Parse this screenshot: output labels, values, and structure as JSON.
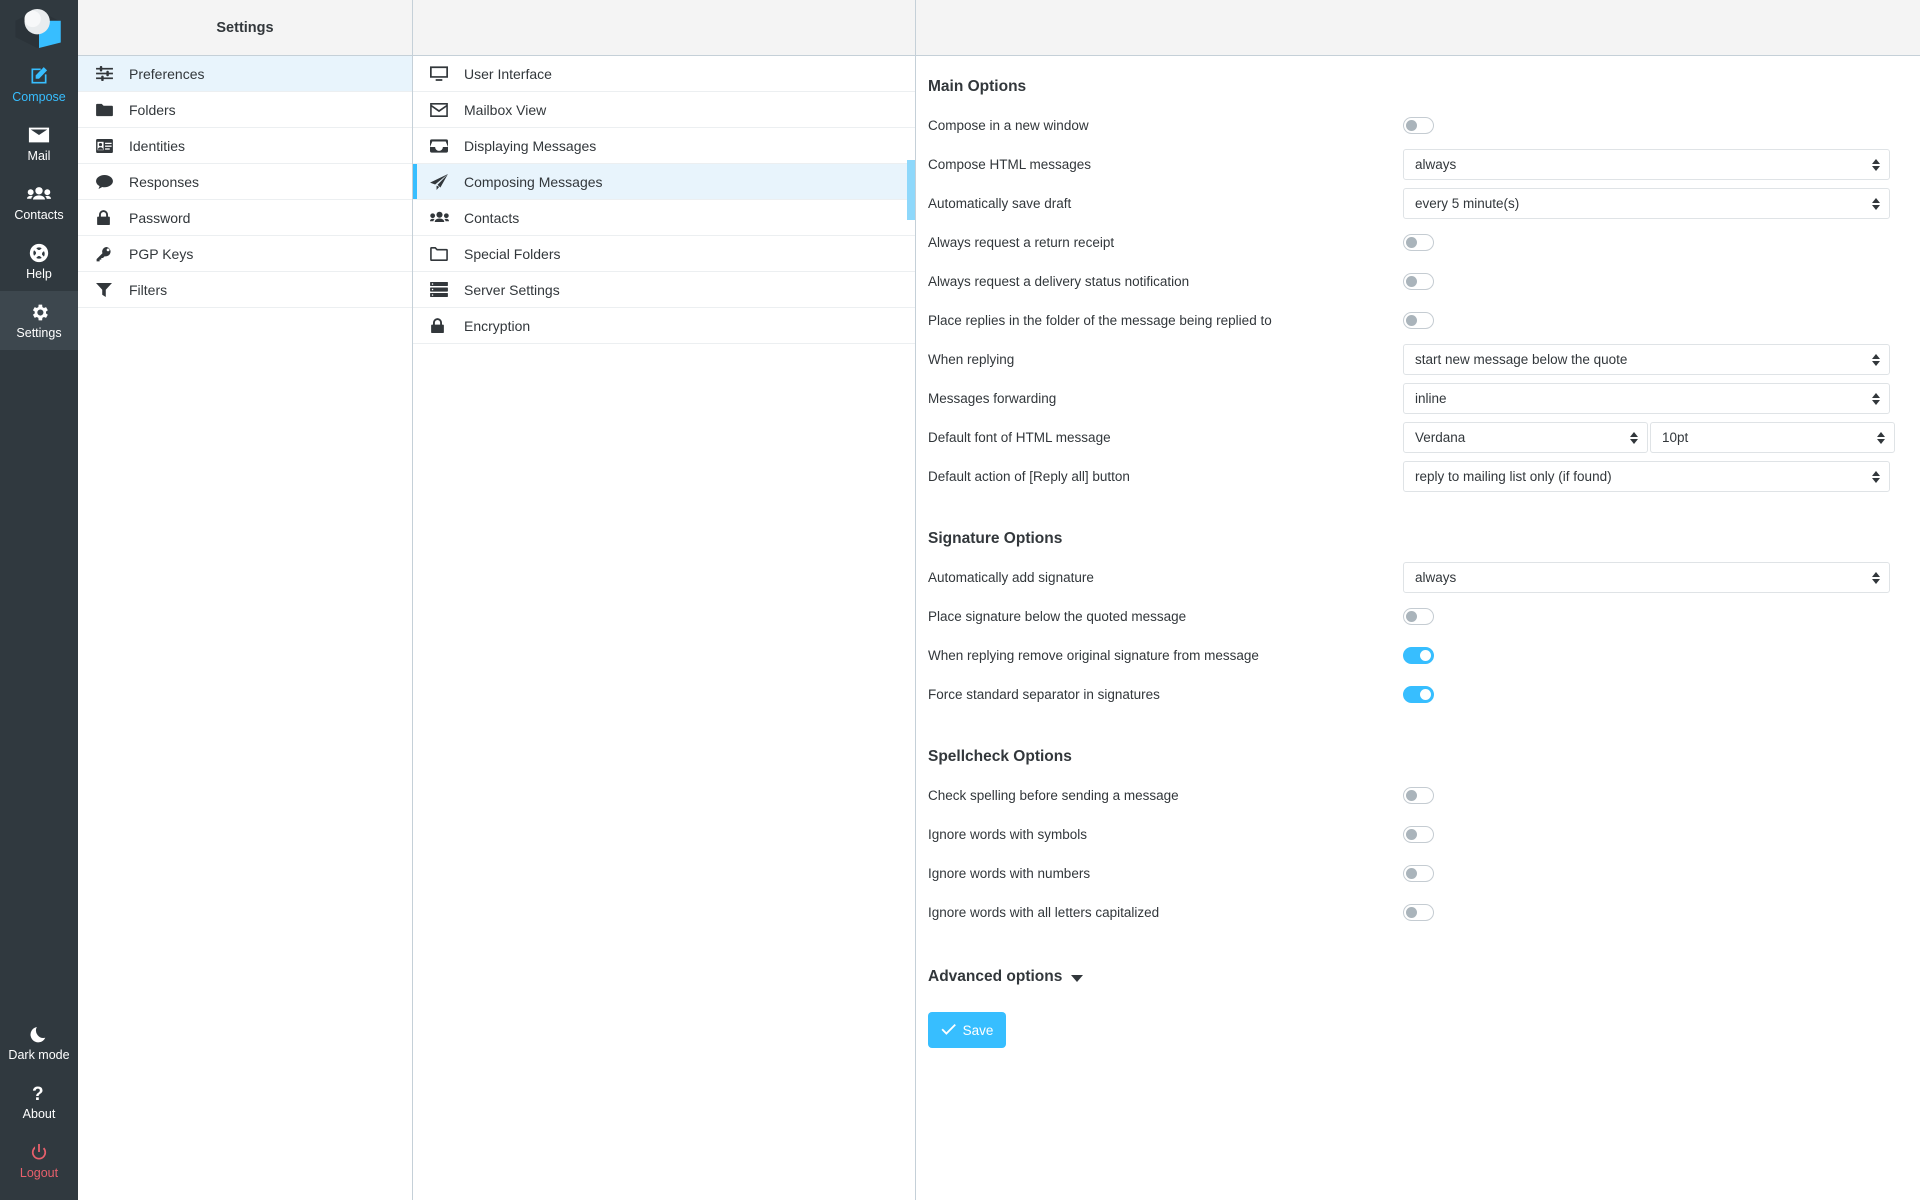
{
  "taskbar": {
    "logo_name": "roundcube-logo",
    "items": [
      {
        "label": "Compose",
        "icon": "compose-icon",
        "accent": true,
        "selected": false
      },
      {
        "label": "Mail",
        "icon": "envelope-icon",
        "accent": false,
        "selected": false
      },
      {
        "label": "Contacts",
        "icon": "people-icon",
        "accent": false,
        "selected": false
      },
      {
        "label": "Help",
        "icon": "lifebuoy-icon",
        "accent": false,
        "selected": false
      },
      {
        "label": "Settings",
        "icon": "gear-icon",
        "accent": false,
        "selected": true
      }
    ],
    "bottom_items": [
      {
        "label": "Dark mode",
        "icon": "moon-icon",
        "danger": false
      },
      {
        "label": "About",
        "icon": "question-mark-icon",
        "danger": false
      },
      {
        "label": "Logout",
        "icon": "power-icon",
        "danger": true
      }
    ]
  },
  "settings_panel": {
    "title": "Settings",
    "items": [
      {
        "label": "Preferences",
        "icon": "sliders-icon",
        "selected": true
      },
      {
        "label": "Folders",
        "icon": "folder-filled-icon",
        "selected": false
      },
      {
        "label": "Identities",
        "icon": "id-card-icon",
        "selected": false
      },
      {
        "label": "Responses",
        "icon": "comment-icon",
        "selected": false
      },
      {
        "label": "Password",
        "icon": "lock-icon",
        "selected": false
      },
      {
        "label": "PGP Keys",
        "icon": "key-icon",
        "selected": false
      },
      {
        "label": "Filters",
        "icon": "funnel-icon",
        "selected": false
      }
    ]
  },
  "prefs_panel": {
    "title": "",
    "items": [
      {
        "label": "User Interface",
        "icon": "monitor-icon",
        "selected": false
      },
      {
        "label": "Mailbox View",
        "icon": "envelope-outline-icon",
        "selected": false
      },
      {
        "label": "Displaying Messages",
        "icon": "inbox-icon",
        "selected": false
      },
      {
        "label": "Composing Messages",
        "icon": "paper-plane-icon",
        "selected": true
      },
      {
        "label": "Contacts",
        "icon": "people-icon",
        "selected": false
      },
      {
        "label": "Special Folders",
        "icon": "folder-outline-icon",
        "selected": false
      },
      {
        "label": "Server Settings",
        "icon": "server-icon",
        "selected": false
      },
      {
        "label": "Encryption",
        "icon": "lock-icon",
        "selected": false
      }
    ]
  },
  "main": {
    "sections": [
      {
        "title": "Main Options",
        "rows": [
          {
            "label": "Compose in a new window",
            "type": "toggle",
            "value": "off"
          },
          {
            "label": "Compose HTML messages",
            "type": "select",
            "value": "always"
          },
          {
            "label": "Automatically save draft",
            "type": "select",
            "value": "every 5 minute(s)"
          },
          {
            "label": "Always request a return receipt",
            "type": "toggle",
            "value": "off"
          },
          {
            "label": "Always request a delivery status notification",
            "type": "toggle",
            "value": "off"
          },
          {
            "label": "Place replies in the folder of the message being replied to",
            "type": "toggle",
            "value": "off"
          },
          {
            "label": "When replying",
            "type": "select",
            "value": "start new message below the quote"
          },
          {
            "label": "Messages forwarding",
            "type": "select",
            "value": "inline"
          },
          {
            "label": "Default font of HTML message",
            "type": "select-pair",
            "value": "Verdana",
            "value2": "10pt"
          },
          {
            "label": "Default action of [Reply all] button",
            "type": "select",
            "value": "reply to mailing list only (if found)"
          }
        ]
      },
      {
        "title": "Signature Options",
        "rows": [
          {
            "label": "Automatically add signature",
            "type": "select",
            "value": "always"
          },
          {
            "label": "Place signature below the quoted message",
            "type": "toggle",
            "value": "off"
          },
          {
            "label": "When replying remove original signature from message",
            "type": "toggle",
            "value": "on"
          },
          {
            "label": "Force standard separator in signatures",
            "type": "toggle",
            "value": "on"
          }
        ]
      },
      {
        "title": "Spellcheck Options",
        "rows": [
          {
            "label": "Check spelling before sending a message",
            "type": "toggle",
            "value": "off"
          },
          {
            "label": "Ignore words with symbols",
            "type": "toggle",
            "value": "off"
          },
          {
            "label": "Ignore words with numbers",
            "type": "toggle",
            "value": "off"
          },
          {
            "label": "Ignore words with all letters capitalized",
            "type": "toggle",
            "value": "off"
          }
        ]
      }
    ],
    "advanced_label": "Advanced options",
    "save_label": "Save"
  },
  "colors": {
    "accent": "#37beff",
    "taskbar_bg": "#30393f",
    "selected_row": "#e8f4fc",
    "logout": "#e8606c",
    "header_bg": "#f4f4f4",
    "text": "#32373b"
  }
}
